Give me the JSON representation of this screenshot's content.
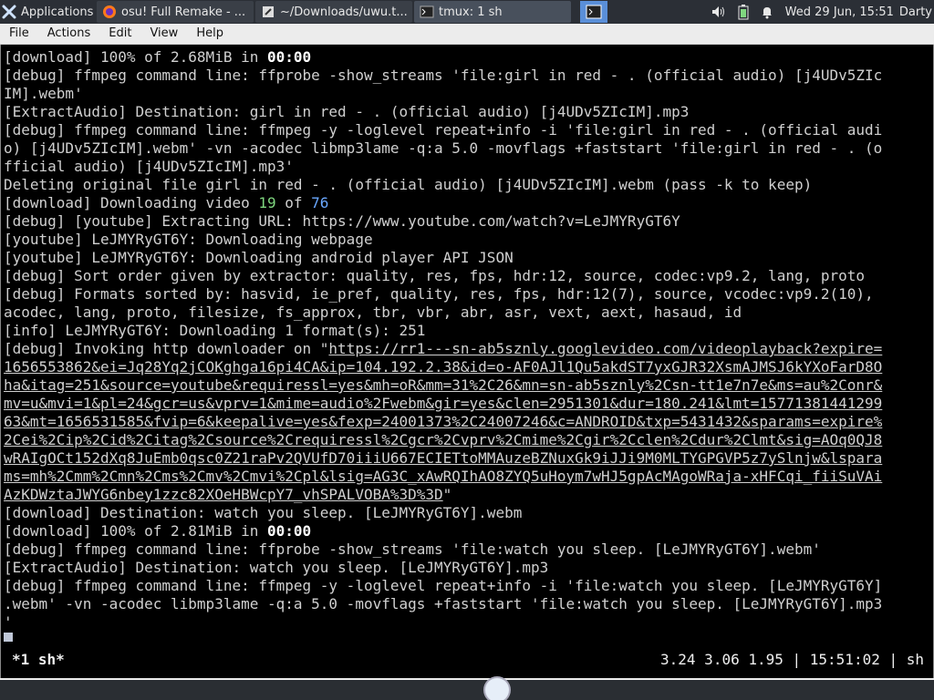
{
  "panel": {
    "applications_label": "Applications",
    "tasks": [
      {
        "label": "osu! Full Remake - ...",
        "icon": "firefox-icon"
      },
      {
        "label": "~/Downloads/uwu.t...",
        "icon": "editor-icon"
      },
      {
        "label": "tmux: 1 sh",
        "icon": "terminal-icon"
      }
    ],
    "clock": "Wed 29 Jun, 15:51",
    "user": "Darty"
  },
  "menubar": {
    "items": [
      "File",
      "Actions",
      "Edit",
      "View",
      "Help"
    ]
  },
  "terminal": {
    "lines": [
      "[download] 100% of 2.68MiB in 00:00",
      "[debug] ffmpeg command line: ffprobe -show_streams 'file:girl in red - . (official audio) [j4UDv5ZIc",
      "IM].webm'",
      "[ExtractAudio] Destination: girl in red - . (official audio) [j4UDv5ZIcIM].mp3",
      "[debug] ffmpeg command line: ffmpeg -y -loglevel repeat+info -i 'file:girl in red - . (official audi",
      "o) [j4UDv5ZIcIM].webm' -vn -acodec libmp3lame -q:a 5.0 -movflags +faststart 'file:girl in red - . (o",
      "fficial audio) [j4UDv5ZIcIM].mp3'",
      "Deleting original file girl in red - . (official audio) [j4UDv5ZIcIM].webm (pass -k to keep)",
      "[download] Downloading video 19 of 76",
      "[debug] [youtube] Extracting URL: https://www.youtube.com/watch?v=LeJMYRyGT6Y",
      "[youtube] LeJMYRyGT6Y: Downloading webpage",
      "[youtube] LeJMYRyGT6Y: Downloading android player API JSON",
      "[debug] Sort order given by extractor: quality, res, fps, hdr:12, source, codec:vp9.2, lang, proto",
      "[debug] Formats sorted by: hasvid, ie_pref, quality, res, fps, hdr:12(7), source, vcodec:vp9.2(10),",
      "acodec, lang, proto, filesize, fs_approx, tbr, vbr, abr, asr, vext, aext, hasaud, id",
      "[info] LeJMYRyGT6Y: Downloading 1 format(s): 251",
      "[debug] Invoking http downloader on \"",
      "1656553862&ei=Jq28Yq2jCOKghga16pi4CA&ip=104.192.2.38&id=o-AF0AJl1Qu5akdST7yxGJR32XsmAJMSJ6kYXoFarD8O",
      "ha&itag=251&source=youtube&requiressl=yes&mh=oR&mm=31%2C26&mn=sn-ab5sznly%2Csn-tt1e7n7e&ms=au%2Conr&",
      "mv=u&mvi=1&pl=24&gcr=us&vprv=1&mime=audio%2Fwebm&gir=yes&clen=2951301&dur=180.241&lmt=15771381441299",
      "63&mt=1656531585&fvip=6&keepalive=yes&fexp=24001373%2C24007246&c=ANDROID&txp=5431432&sparams=expire%",
      "2Cei%2Cip%2Cid%2Citag%2Csource%2Crequiressl%2Cgcr%2Cvprv%2Cmime%2Cgir%2Cclen%2Cdur%2Clmt&sig=AOq0QJ8",
      "wRAIgOCt152dXq8JuEmb0qsc0Z21raPv2QVUfD70iiiU667ECIETtoMMAuzeBZNuxGk9iJJi9M0MLTYGPGVP5z7ySlnjw&lspara",
      "ms=mh%2Cmm%2Cmn%2Cms%2Cmv%2Cmvi%2Cpl&lsig=AG3C_xAwRQIhAO8ZYQ5uHoym7wHJ5gpAcMAgoWRaja-xHFCqi_fiiSuVAi",
      "AzKDWztaJWYG6nbey1zzc82XOeHBWcpY7_vhSPALVOBA%3D%3D",
      "[download] Destination: watch you sleep. [LeJMYRyGT6Y].webm",
      "[download] 100% of 2.81MiB in 00:00",
      "[debug] ffmpeg command line: ffprobe -show_streams 'file:watch you sleep. [LeJMYRyGT6Y].webm'",
      "[ExtractAudio] Destination: watch you sleep. [LeJMYRyGT6Y].mp3",
      "[debug] ffmpeg command line: ffmpeg -y -loglevel repeat+info -i 'file:watch you sleep. [LeJMYRyGT6Y]",
      ".webm' -vn -acodec libmp3lame -q:a 5.0 -movflags +faststart 'file:watch you sleep. [LeJMYRyGT6Y].mp3",
      "'"
    ],
    "url_start": "https://rr1---sn-ab5sznly.googlevideo.com/videoplayback?expire=",
    "bold_time_1": "00:00",
    "bold_time_2": "00:00",
    "video_num": "19",
    "video_total": "76"
  },
  "tmux_status": {
    "left": "*1 sh*",
    "right": "3.24 3.06 1.95 | 15:51:02 | sh"
  },
  "colors": {
    "panel_bg": "#2b2f36",
    "terminal_bg": "#000000",
    "terminal_fg": "#d0d0d0",
    "number_green": "#7fd77f",
    "number_blue": "#6aa8ff"
  }
}
